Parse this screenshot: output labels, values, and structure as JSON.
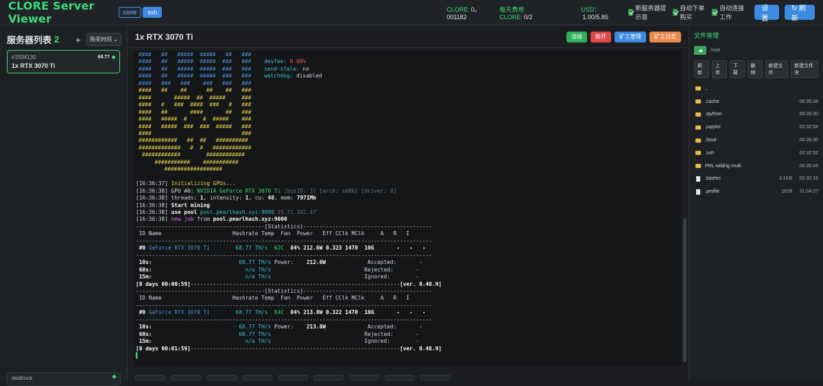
{
  "header": {
    "app_title": "CLORE Server Viewer",
    "tabs": [
      "clore",
      "ssh"
    ],
    "clore_label": "CLORE:",
    "clore_value": "0。001182",
    "daily_label": "每天费用CLORE:",
    "daily_value": "0/2",
    "usd_label": "USD：",
    "usd_value": "1.00/5.85",
    "checkbox_new_server": "新服务器提示音",
    "checkbox_auto_buy": "自动下单购买",
    "checkbox_auto_connect": "自动连接工作",
    "settings_button": "设置",
    "refresh_button": "↻ 刷新"
  },
  "sidebar": {
    "title": "服务器列表",
    "count": "2",
    "add": "+",
    "sort_select": "购买时间 ⌄",
    "servers": [
      {
        "id": "#1934130",
        "rate": "68.77",
        "name": "1x RTX 3070 Ti"
      },
      {
        "id": "dedirock"
      }
    ]
  },
  "main": {
    "title": "1x RTX 3070 Ti",
    "buttons": {
      "connect": "连接",
      "disconnect": "断开",
      "miner_manage": "矿工管理",
      "miner_log": "矿工日志"
    },
    "colors": {
      "connect": "#2fb35a",
      "disconnect": "#e04848",
      "miner_manage": "#3d8be0",
      "miner_log": "#e88a4d"
    }
  },
  "terminal": {
    "lines": [
      [
        [
          "####   ##   #####  #####   ##   ###",
          "b"
        ]
      ],
      [
        [
          "####   ##   #####  #####  ###   ###    ",
          "b"
        ],
        [
          "devfee: ",
          "c"
        ],
        [
          "0.00%",
          "r"
        ]
      ],
      [
        [
          "####   ##   #####  #####  ###   ###    ",
          "b"
        ],
        [
          "send-stale: ",
          "c"
        ],
        [
          "no",
          ""
        ]
      ],
      [
        [
          "####   ##   #####  #####  ###   ###    ",
          "b"
        ],
        [
          "watchdog: ",
          "c"
        ],
        [
          "disabled",
          ""
        ]
      ],
      [
        [
          "####   ###   ###    ###   ###   ###",
          "b"
        ]
      ],
      [
        [
          "####   ##    ##      ##    ##   ###",
          "y"
        ]
      ],
      [
        [
          "####       #####  ##  #####     ###",
          "y"
        ]
      ],
      [
        [
          "####   #   ###  ####  ###   #   ###",
          "y"
        ]
      ],
      [
        [
          "####   ##       ####       ##   ###",
          "y"
        ]
      ],
      [
        [
          "####   #####  #     #  #####    ###",
          "y"
        ]
      ],
      [
        [
          "####   #####  ###  ###  #####   ###",
          "y"
        ]
      ],
      [
        [
          "####                            ###",
          "y"
        ]
      ],
      [
        [
          "############   ##  ##   ##########",
          "y"
        ]
      ],
      [
        [
          "#############   #  #   ############",
          "y"
        ]
      ],
      [
        [
          " ############        ############",
          "y"
        ]
      ],
      [
        [
          "     ###########    ###########",
          "y"
        ]
      ],
      [
        [
          "        ##################",
          "y"
        ]
      ],
      [
        [
          "",
          ""
        ]
      ],
      [
        [
          "[16:36:37] ",
          ""
        ],
        [
          "Initializing GPUs...",
          "y"
        ]
      ],
      [
        [
          "[16:36:38] GPU #0: ",
          ""
        ],
        [
          "NVIDIA GeForce RTX 3070 Ti",
          "g"
        ],
        [
          " [busID: 3] [arch: sm86] [driver: 0]",
          "d"
        ]
      ],
      [
        [
          "[16:36:38] threads: ",
          ""
        ],
        [
          "1",
          "w"
        ],
        [
          ", intensity: ",
          ""
        ],
        [
          "1",
          "w"
        ],
        [
          ", cu: ",
          ""
        ],
        [
          "48",
          "w"
        ],
        [
          ", mem: ",
          ""
        ],
        [
          "7971Mb",
          "w"
        ]
      ],
      [
        [
          "[16:36:38] ",
          ""
        ],
        [
          "Start mining",
          "w"
        ]
      ],
      [
        [
          "[16:36:38] ",
          ""
        ],
        [
          "use pool ",
          "w"
        ],
        [
          "pool.pearlhash.xyz:9000",
          "c"
        ],
        [
          " 35.71.142.47",
          "d"
        ]
      ],
      [
        [
          "[16:36:38] ",
          ""
        ],
        [
          "new job",
          "m"
        ],
        [
          " from ",
          ""
        ],
        [
          "pool.pearlhash.xyz:9000",
          "w"
        ]
      ],
      [
        [
          "----------------------------------------[Statistics]----------------------------------------",
          ""
        ]
      ],
      [
        [
          " ID Name                      Hashrate Temp  Fan  Power   Eff CClk MClk     A   R   I",
          ""
        ]
      ],
      [
        [
          "--------------------------------------------------------------------------------------------",
          ""
        ]
      ],
      [
        [
          " #0 ",
          "w"
        ],
        [
          "GeForce RTX 3070 Ti",
          "b"
        ],
        [
          "        ",
          ""
        ],
        [
          "68.77 TH/s",
          "c"
        ],
        [
          "  62C  ",
          "g"
        ],
        [
          "84% 212.6W 0.323 1470  10G       -   -   -",
          "w"
        ]
      ],
      [
        [
          "--------------------------------------------------------------------------------------------",
          ""
        ]
      ],
      [
        [
          " 10s:                           ",
          "w"
        ],
        [
          "68.77 TH/s",
          "c"
        ],
        [
          " Power:    ",
          ""
        ],
        [
          "212.6W",
          "w"
        ],
        [
          "             Accepted:       -",
          ""
        ]
      ],
      [
        [
          " 60s:                             ",
          "w"
        ],
        [
          "n/a TH/s",
          "c"
        ],
        [
          "                             Rejected:       -",
          ""
        ]
      ],
      [
        [
          " 15m:                             ",
          "w"
        ],
        [
          "n/a TH/s",
          "c"
        ],
        [
          "                             Ignored:        -",
          ""
        ]
      ],
      [
        [
          "[0 days 00:00:59]",
          "w"
        ],
        [
          "-----------------------------------------------------------------",
          ""
        ],
        [
          "[ver. 0.48.9]",
          "w"
        ]
      ],
      [
        [
          "----------------------------------------[Statistics]----------------------------------------",
          ""
        ]
      ],
      [
        [
          " ID Name                      Hashrate Temp  Fan  Power   Eff CClk MClk     A   R   I",
          ""
        ]
      ],
      [
        [
          "--------------------------------------------------------------------------------------------",
          ""
        ]
      ],
      [
        [
          " #0 ",
          "w"
        ],
        [
          "GeForce RTX 3070 Ti",
          "b"
        ],
        [
          "        ",
          ""
        ],
        [
          "68.77 TH/s",
          "c"
        ],
        [
          "  64C  ",
          "g"
        ],
        [
          "84% 213.8W 0.322 1470  10G       -   -   -",
          "w"
        ]
      ],
      [
        [
          "--------------------------------------------------------------------------------------------",
          ""
        ]
      ],
      [
        [
          " 10s:                           ",
          "w"
        ],
        [
          "68.77 TH/s",
          "c"
        ],
        [
          " Power:    ",
          ""
        ],
        [
          "213.8W",
          "w"
        ],
        [
          "             Accepted:       -",
          ""
        ]
      ],
      [
        [
          " 60s:                           ",
          "w"
        ],
        [
          "68.77 TH/s",
          "c"
        ],
        [
          "                             Rejected:       -",
          ""
        ]
      ],
      [
        [
          " 15m:                             ",
          "w"
        ],
        [
          "n/a TH/s",
          "c"
        ],
        [
          "                             Ignored:        -",
          ""
        ]
      ],
      [
        [
          "[0 days 00:01:59]",
          "w"
        ],
        [
          "-----------------------------------------------------------------",
          ""
        ],
        [
          "[ver. 0.48.9]",
          "w"
        ]
      ],
      [
        [
          "▌",
          "g"
        ]
      ]
    ]
  },
  "files": {
    "title": "文件管理",
    "back": "◀",
    "path": "/root",
    "toolbar": [
      "刷新",
      "上传",
      "下载",
      "删除",
      "新建文件",
      "新建文件夹"
    ],
    "items": [
      {
        "name": "..",
        "type": "dir",
        "size": "",
        "time": ""
      },
      {
        "name": ".cache",
        "type": "dir",
        "size": "",
        "time": "00:35:34"
      },
      {
        "name": ".ipython",
        "type": "dir",
        "size": "",
        "time": "00:35:30"
      },
      {
        "name": ".jupyter",
        "type": "dir",
        "size": "",
        "time": "02:32:54"
      },
      {
        "name": ".local",
        "type": "dir",
        "size": "",
        "time": "00:35:30"
      },
      {
        "name": ".ssh",
        "type": "dir",
        "size": "",
        "time": "02:32:52"
      },
      {
        "name": "PRL-wildrig-multi",
        "type": "dir",
        "size": "",
        "time": "00:35:43"
      },
      {
        "name": ".bashrc",
        "type": "file",
        "size": "3.1KB",
        "time": "02:32:15"
      },
      {
        "name": ".profile",
        "type": "file",
        "size": "1618",
        "time": "21:04:27"
      }
    ]
  }
}
